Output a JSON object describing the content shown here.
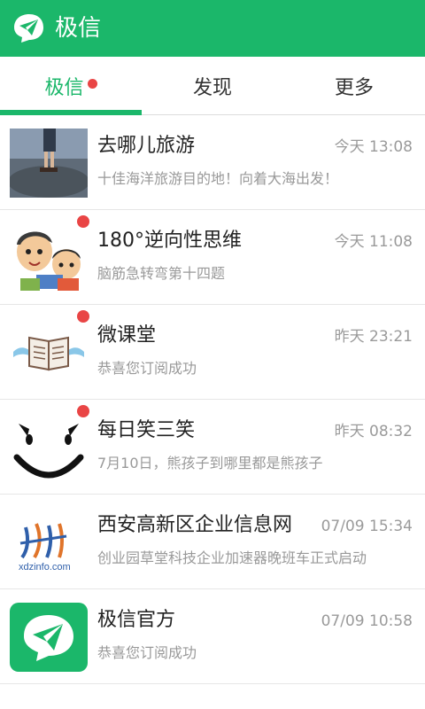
{
  "header": {
    "title": "极信",
    "logo_icon": "paper-plane-logo-icon"
  },
  "tabs": [
    {
      "label": "极信",
      "active": true,
      "unread_dot": true
    },
    {
      "label": "发现",
      "active": false,
      "unread_dot": false
    },
    {
      "label": "更多",
      "active": false,
      "unread_dot": false
    }
  ],
  "conversations": [
    {
      "name": "去哪儿旅游",
      "time": "今天 13:08",
      "preview": "十佳海洋旅游目的地！向着大海出发！",
      "avatar": "travel-photo-avatar",
      "unread": false
    },
    {
      "name": "180°逆向性思维",
      "time": "今天 11:08",
      "preview": "脑筋急转弯第十四题",
      "avatar": "cartoon-kids-avatar",
      "unread": true
    },
    {
      "name": "微课堂",
      "time": "昨天 23:21",
      "preview": "恭喜您订阅成功",
      "avatar": "winged-book-avatar",
      "unread": true
    },
    {
      "name": "每日笑三笑",
      "time": "昨天 08:32",
      "preview": "7月10日，熊孩子到哪里都是熊孩子",
      "avatar": "smiley-face-avatar",
      "unread": true
    },
    {
      "name": "西安高新区企业信息网",
      "time": "07/09 15:34",
      "preview": "创业园草堂科技企业加速器晚班车正式启动",
      "avatar": "xdzinfo-logo-avatar",
      "avatar_text": "xdzinfo.com",
      "unread": false
    },
    {
      "name": "极信官方",
      "time": "07/09 10:58",
      "preview": "恭喜您订阅成功",
      "avatar": "jixin-official-avatar",
      "unread": false
    }
  ],
  "colors": {
    "brand": "#1bb76a",
    "unread": "#e94545"
  }
}
